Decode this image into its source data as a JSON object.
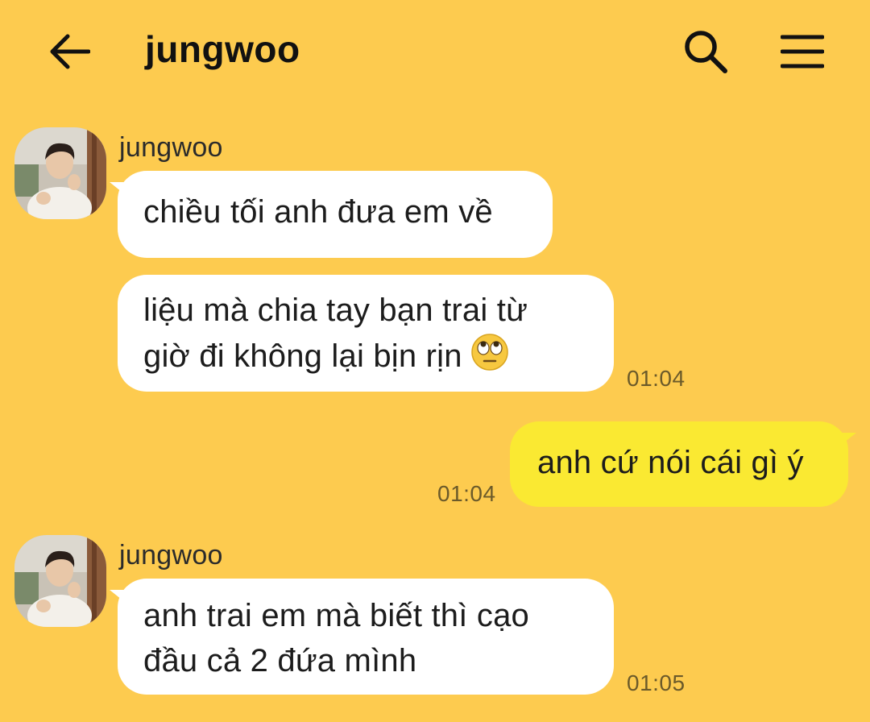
{
  "header": {
    "title": "jungwoo",
    "back_icon": "arrow-left-icon",
    "search_icon": "search-icon",
    "menu_icon": "hamburger-menu-icon"
  },
  "colors": {
    "background": "#fdcb4f",
    "incoming_bubble": "#ffffff",
    "outgoing_bubble": "#fae932",
    "timestamp": "#6b5a2a"
  },
  "messages": {
    "group1": {
      "sender": "jungwoo",
      "msg1": "chiều tối anh đưa em về",
      "msg2_line1": "liệu mà chia tay bạn trai từ",
      "msg2_line2": "giờ đi không lại bịn rịn",
      "msg2_emoji": "face-with-rolling-eyes-emoji",
      "time": "01:04"
    },
    "outgoing1": {
      "text": "anh cứ nói cái gì ý",
      "time": "01:04"
    },
    "group2": {
      "sender": "jungwoo",
      "msg1_line1": "anh trai em mà biết thì cạo",
      "msg1_line2": "đầu cả 2 đứa mình",
      "time": "01:05"
    }
  }
}
